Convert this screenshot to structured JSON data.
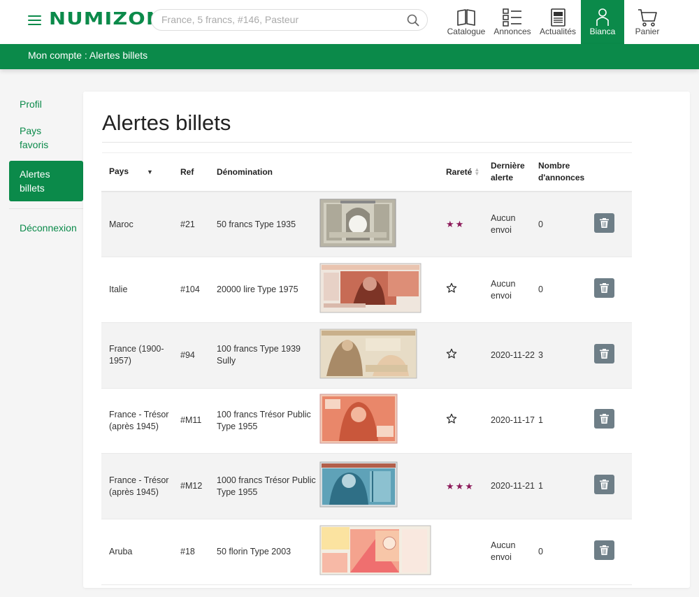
{
  "header": {
    "logo": "NUMIZON",
    "search_placeholder": "France, 5 francs, #146, Pasteur",
    "nav": [
      {
        "label": "Catalogue",
        "icon": "book-icon"
      },
      {
        "label": "Annonces",
        "icon": "list-icon"
      },
      {
        "label": "Actualités",
        "icon": "newspaper-icon"
      },
      {
        "label": "Bianca",
        "icon": "user-icon"
      },
      {
        "label": "Panier",
        "icon": "cart-icon"
      }
    ]
  },
  "breadcrumb": "Mon compte : Alertes billets",
  "sidebar": {
    "items": [
      {
        "label": "Profil"
      },
      {
        "label": "Pays favoris"
      },
      {
        "label": "Alertes billets"
      },
      {
        "label": "Déconnexion"
      }
    ]
  },
  "page_title": "Alertes billets",
  "table": {
    "headers": {
      "pays": "Pays",
      "ref": "Ref",
      "denomination": "Dénomination",
      "rarete": "Rareté",
      "derniere": "Dernière alerte",
      "nombre": "Nombre d'annonces"
    },
    "rows": [
      {
        "pays": "Maroc",
        "ref": "#21",
        "denomination": "50 francs Type 1935",
        "stars": "★★",
        "rarity": 2,
        "derniere": "Aucun envoi",
        "nombre": "0"
      },
      {
        "pays": "Italie",
        "ref": "#104",
        "denomination": "20000 lire Type 1975",
        "stars": "",
        "rarity": 0,
        "derniere": "Aucun envoi",
        "nombre": "0"
      },
      {
        "pays": "France (1900-1957)",
        "ref": "#94",
        "denomination": "100 francs Type 1939 Sully",
        "stars": "",
        "rarity": 0,
        "derniere": "2020-11-22",
        "nombre": "3"
      },
      {
        "pays": "France - Trésor (après 1945)",
        "ref": "#M11",
        "denomination": "100 francs Trésor Public Type 1955",
        "stars": "",
        "rarity": 0,
        "derniere": "2020-11-17",
        "nombre": "1"
      },
      {
        "pays": "France - Trésor (après 1945)",
        "ref": "#M12",
        "denomination": "1000 francs Trésor Public Type 1955",
        "stars": "★★★",
        "rarity": 3,
        "derniere": "2020-11-21",
        "nombre": "1"
      },
      {
        "pays": "Aruba",
        "ref": "#18",
        "denomination": "50 florin Type 2003",
        "stars": "",
        "rarity": -1,
        "derniere": "Aucun envoi",
        "nombre": "0"
      }
    ]
  },
  "colors": {
    "brand_green": "#0b8a4a",
    "star_purple": "#8c1a5a",
    "delete_button": "#6e7e87"
  }
}
